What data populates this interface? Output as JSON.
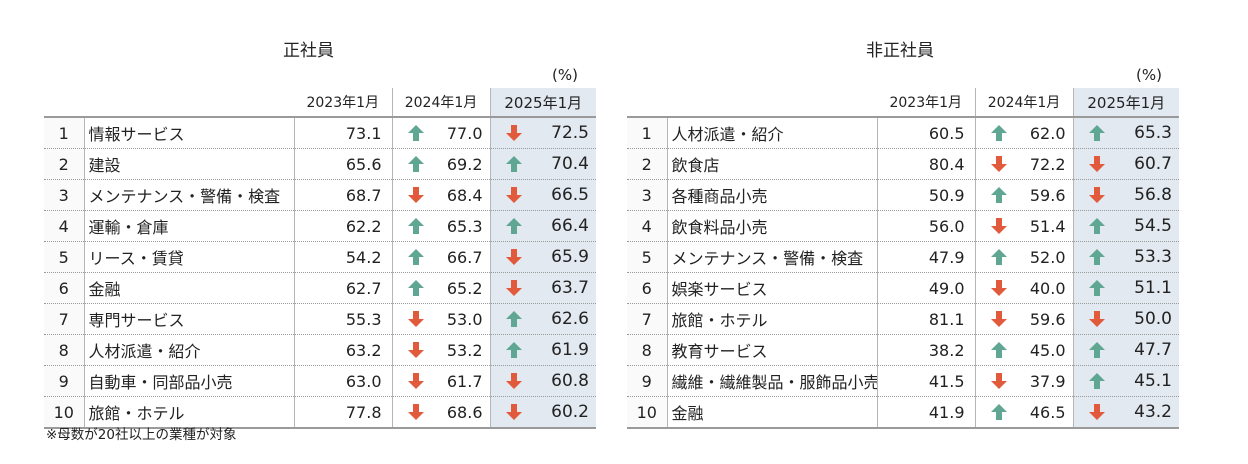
{
  "footnote": "※母数が20社以上の業種が対象",
  "colors": {
    "up": "#5fa693",
    "down": "#e25a3c",
    "highlight": "#e3e9f1"
  },
  "icons": {
    "up": "up-arrow-icon",
    "down": "down-arrow-icon"
  },
  "panels": [
    {
      "title": "正社員",
      "unit": "(%)",
      "columns": [
        "2023年1月",
        "2024年1月",
        "2025年1月"
      ],
      "rows": [
        {
          "rank": "1",
          "industry": "情報サービス",
          "v2023": "73.1",
          "v2024": "77.0",
          "t2024": "up",
          "v2025": "72.5",
          "t2025": "down"
        },
        {
          "rank": "2",
          "industry": "建設",
          "v2023": "65.6",
          "v2024": "69.2",
          "t2024": "up",
          "v2025": "70.4",
          "t2025": "up"
        },
        {
          "rank": "3",
          "industry": "メンテナンス・警備・検査",
          "v2023": "68.7",
          "v2024": "68.4",
          "t2024": "down",
          "v2025": "66.5",
          "t2025": "down"
        },
        {
          "rank": "4",
          "industry": "運輸・倉庫",
          "v2023": "62.2",
          "v2024": "65.3",
          "t2024": "up",
          "v2025": "66.4",
          "t2025": "up"
        },
        {
          "rank": "5",
          "industry": "リース・賃貸",
          "v2023": "54.2",
          "v2024": "66.7",
          "t2024": "up",
          "v2025": "65.9",
          "t2025": "down"
        },
        {
          "rank": "6",
          "industry": "金融",
          "v2023": "62.7",
          "v2024": "65.2",
          "t2024": "up",
          "v2025": "63.7",
          "t2025": "down"
        },
        {
          "rank": "7",
          "industry": "専門サービス",
          "v2023": "55.3",
          "v2024": "53.0",
          "t2024": "down",
          "v2025": "62.6",
          "t2025": "up"
        },
        {
          "rank": "8",
          "industry": "人材派遣・紹介",
          "v2023": "63.2",
          "v2024": "53.2",
          "t2024": "down",
          "v2025": "61.9",
          "t2025": "up"
        },
        {
          "rank": "9",
          "industry": "自動車・同部品小売",
          "v2023": "63.0",
          "v2024": "61.7",
          "t2024": "down",
          "v2025": "60.8",
          "t2025": "down"
        },
        {
          "rank": "10",
          "industry": "旅館・ホテル",
          "v2023": "77.8",
          "v2024": "68.6",
          "t2024": "down",
          "v2025": "60.2",
          "t2025": "down"
        }
      ]
    },
    {
      "title": "非正社員",
      "unit": "(%)",
      "columns": [
        "2023年1月",
        "2024年1月",
        "2025年1月"
      ],
      "rows": [
        {
          "rank": "1",
          "industry": "人材派遣・紹介",
          "v2023": "60.5",
          "v2024": "62.0",
          "t2024": "up",
          "v2025": "65.3",
          "t2025": "up"
        },
        {
          "rank": "2",
          "industry": "飲食店",
          "v2023": "80.4",
          "v2024": "72.2",
          "t2024": "down",
          "v2025": "60.7",
          "t2025": "down"
        },
        {
          "rank": "3",
          "industry": "各種商品小売",
          "v2023": "50.9",
          "v2024": "59.6",
          "t2024": "up",
          "v2025": "56.8",
          "t2025": "down"
        },
        {
          "rank": "4",
          "industry": "飲食料品小売",
          "v2023": "56.0",
          "v2024": "51.4",
          "t2024": "down",
          "v2025": "54.5",
          "t2025": "up"
        },
        {
          "rank": "5",
          "industry": "メンテナンス・警備・検査",
          "v2023": "47.9",
          "v2024": "52.0",
          "t2024": "up",
          "v2025": "53.3",
          "t2025": "up"
        },
        {
          "rank": "6",
          "industry": "娯楽サービス",
          "v2023": "49.0",
          "v2024": "40.0",
          "t2024": "down",
          "v2025": "51.1",
          "t2025": "up"
        },
        {
          "rank": "7",
          "industry": "旅館・ホテル",
          "v2023": "81.1",
          "v2024": "59.6",
          "t2024": "down",
          "v2025": "50.0",
          "t2025": "down"
        },
        {
          "rank": "8",
          "industry": "教育サービス",
          "v2023": "38.2",
          "v2024": "45.0",
          "t2024": "up",
          "v2025": "47.7",
          "t2025": "up"
        },
        {
          "rank": "9",
          "industry": "繊維・繊維製品・服飾品小売",
          "v2023": "41.5",
          "v2024": "37.9",
          "t2024": "down",
          "v2025": "45.1",
          "t2025": "up"
        },
        {
          "rank": "10",
          "industry": "金融",
          "v2023": "41.9",
          "v2024": "46.5",
          "t2024": "up",
          "v2025": "43.2",
          "t2025": "down"
        }
      ]
    }
  ]
}
